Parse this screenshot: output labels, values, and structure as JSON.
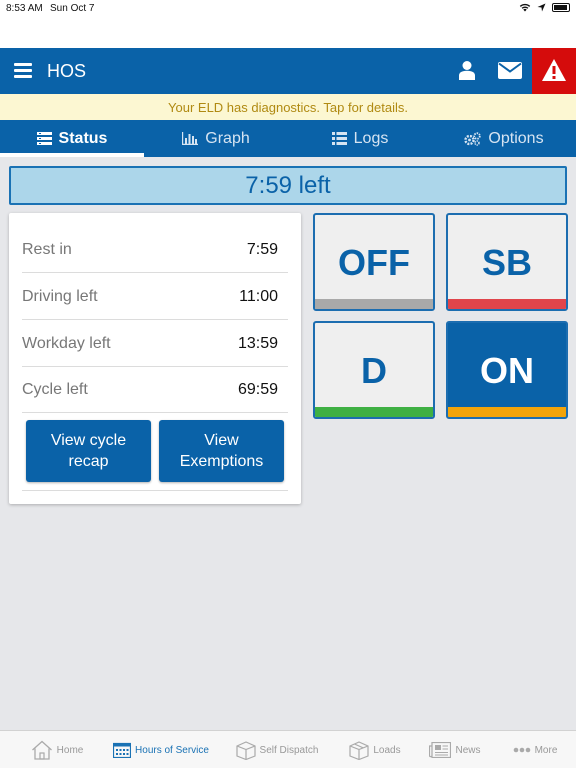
{
  "status_bar": {
    "time": "8:53 AM",
    "date": "Sun Oct 7"
  },
  "header": {
    "title": "HOS"
  },
  "banner": {
    "text": "Your ELD has diagnostics. Tap for details."
  },
  "tabs": [
    {
      "label": "Status",
      "icon": "status-list-icon",
      "active": true
    },
    {
      "label": "Graph",
      "icon": "bar-graph-icon",
      "active": false
    },
    {
      "label": "Logs",
      "icon": "list-icon",
      "active": false
    },
    {
      "label": "Options",
      "icon": "gears-icon",
      "active": false
    }
  ],
  "time_left": "7:59 left",
  "summary": {
    "rows": [
      {
        "label": "Rest in",
        "value": "7:59"
      },
      {
        "label": "Driving left",
        "value": "11:00"
      },
      {
        "label": "Workday left",
        "value": "13:59"
      },
      {
        "label": "Cycle left",
        "value": "69:59"
      }
    ],
    "buttons": {
      "recap": "View cycle recap",
      "exemptions": "View Exemptions"
    }
  },
  "duty_status": [
    {
      "code": "OFF",
      "strip_color": "#a9a9a9",
      "active": false
    },
    {
      "code": "SB",
      "strip_color": "#e0454b",
      "active": false
    },
    {
      "code": "D",
      "strip_color": "#3fb043",
      "active": false
    },
    {
      "code": "ON",
      "strip_color": "#f3a40a",
      "active": true
    }
  ],
  "bottom_nav": [
    {
      "label": "Home",
      "icon": "home-icon",
      "active": false
    },
    {
      "label": "Hours of Service",
      "icon": "calendar-icon",
      "active": true
    },
    {
      "label": "Self Dispatch",
      "icon": "box-icon",
      "active": false
    },
    {
      "label": "Loads",
      "icon": "package-icon",
      "active": false
    },
    {
      "label": "News",
      "icon": "newspaper-icon",
      "active": false
    },
    {
      "label": "More",
      "icon": "more-dots-icon",
      "active": false
    }
  ],
  "colors": {
    "brand": "#0a62a8",
    "alert": "#d50c0c",
    "banner_text": "#b08a12"
  }
}
